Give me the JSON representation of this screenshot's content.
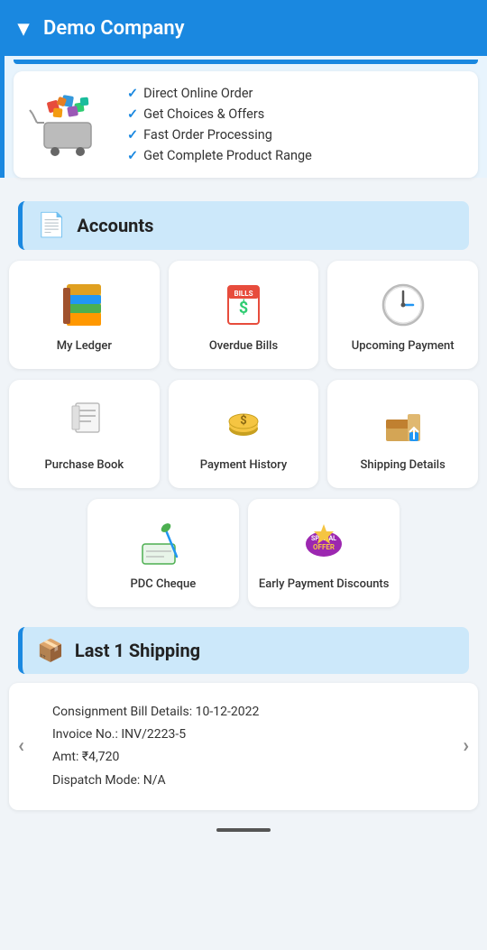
{
  "header": {
    "title": "Demo Company",
    "chevron": "▾"
  },
  "promo": {
    "items": [
      "Direct Online Order",
      "Get Choices & Offers",
      "Fast Order Processing",
      "Get Complete Product Range"
    ]
  },
  "accounts_section": {
    "label": "Accounts",
    "items_row1": [
      {
        "id": "my-ledger",
        "label": "My Ledger",
        "icon": "📚"
      },
      {
        "id": "overdue-bills",
        "label": "Overdue Bills",
        "icon": "💵"
      },
      {
        "id": "upcoming-payment",
        "label": "Upcoming Payment",
        "icon": "🕐"
      }
    ],
    "items_row2": [
      {
        "id": "purchase-book",
        "label": "Purchase Book",
        "icon": "🧾"
      },
      {
        "id": "payment-history",
        "label": "Payment History",
        "icon": "💰"
      },
      {
        "id": "shipping-details",
        "label": "Shipping Details",
        "icon": "📦"
      }
    ],
    "items_row3": [
      {
        "id": "pdc-cheque",
        "label": "PDC Cheque",
        "icon": "🖊️"
      },
      {
        "id": "early-payment-discounts",
        "label": "Early Payment Discounts",
        "icon": "🏷️"
      }
    ]
  },
  "last_shipping": {
    "label": "Last 1 Shipping",
    "consignment_label": "Consignment Bill Details:",
    "consignment_date": "10-12-2022",
    "invoice_label": "Invoice No.:",
    "invoice_value": "INV/2223-5",
    "amount_label": "Amt:",
    "amount_value": "₹4,720",
    "dispatch_label": "Dispatch Mode:",
    "dispatch_value": "N/A"
  }
}
